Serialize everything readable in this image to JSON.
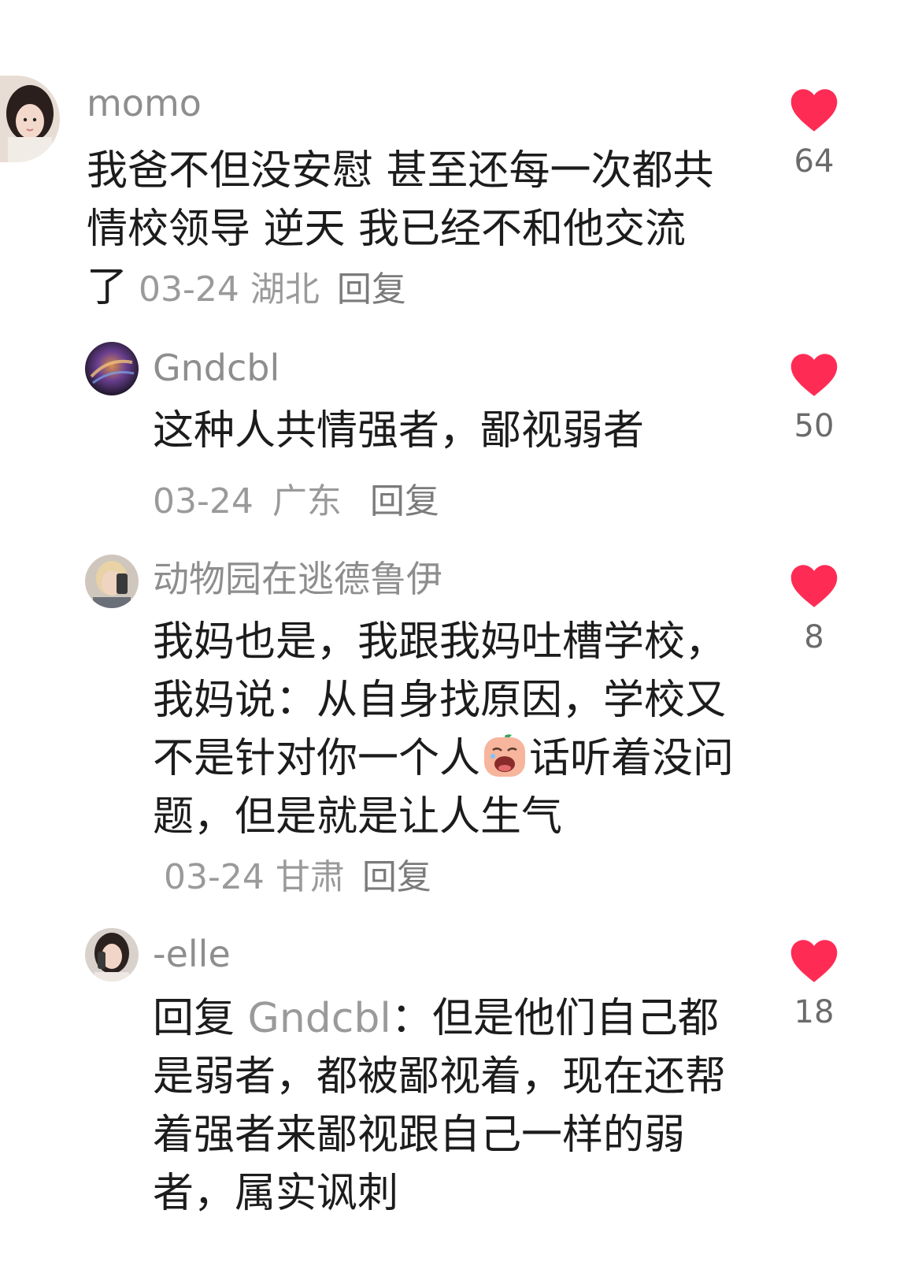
{
  "comments": [
    {
      "username": "momo",
      "text": "我爸不但没安慰 甚至还每一次都共情校领导 逆天 我已经不和他交流了",
      "date": "03-24",
      "location": "湖北",
      "reply_label": "回复",
      "likes": "64",
      "avatar": "portrait-avatar"
    },
    {
      "username": "Gndcbl",
      "text": "这种人共情强者，鄙视弱者",
      "date": "03-24",
      "location": "广东",
      "reply_label": "回复",
      "likes": "50",
      "avatar": "galaxy-avatar"
    },
    {
      "username": "动物园在逃德鲁伊",
      "text_before_emoji": "我妈也是，我跟我妈吐槽学校，我妈说：从自身找原因，学校又不是针对你一个人",
      "emoji": "crying-peach-emoji",
      "text_after_emoji": "话听着没问题，但是就是让人生气",
      "date": "03-24",
      "location": "甘肃",
      "reply_label": "回复",
      "likes": "8",
      "avatar": "selfie-avatar"
    },
    {
      "username": "-elle",
      "reply_prefix": "回复",
      "mention": "Gndcbl",
      "text": "：但是他们自己都是弱者，都被鄙视着，现在还帮着强者来鄙视跟自己一样的弱者，属实讽刺",
      "likes": "18",
      "avatar": "portrait-avatar"
    }
  ],
  "icons": {
    "like": "heart-icon"
  },
  "colors": {
    "heart": "#fe2c55",
    "meta_text": "#9a9a9a",
    "username": "#8e8e8e",
    "body_text": "#1c1c1c"
  }
}
